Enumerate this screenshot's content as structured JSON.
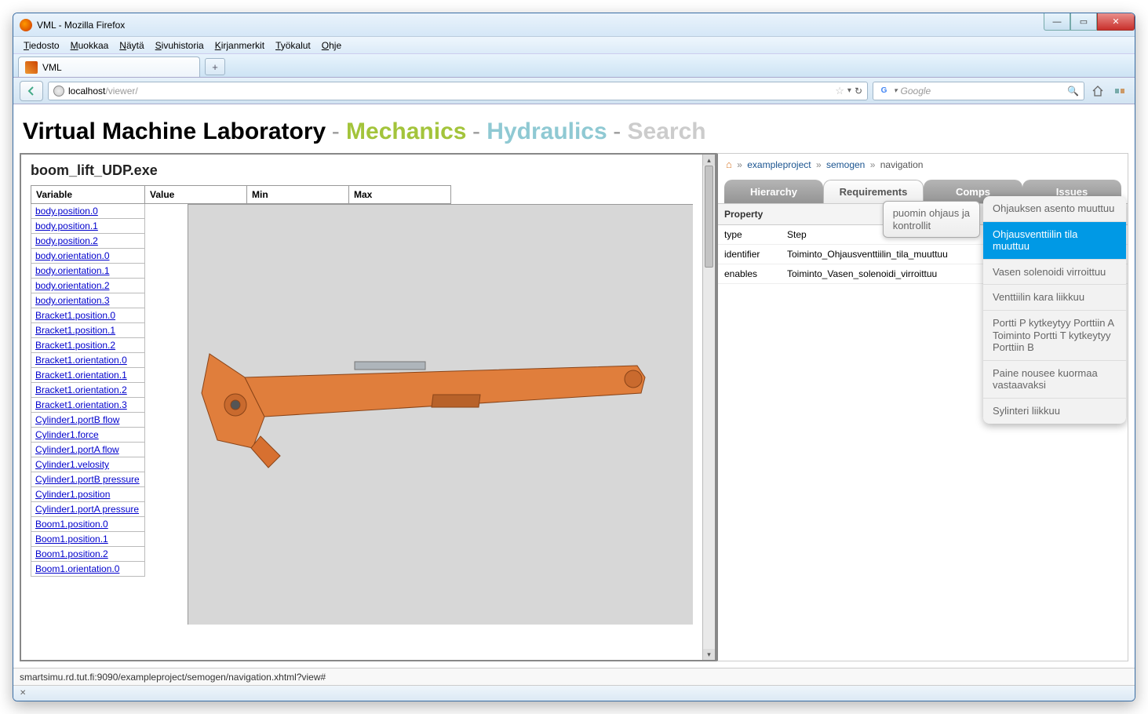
{
  "window": {
    "title": "VML - Mozilla Firefox"
  },
  "menubar": {
    "items": [
      "Tiedosto",
      "Muokkaa",
      "Näytä",
      "Sivuhistoria",
      "Kirjanmerkit",
      "Työkalut",
      "Ohje"
    ]
  },
  "tab": {
    "label": "VML"
  },
  "urlbar": {
    "host": "localhost",
    "path": "/viewer/"
  },
  "search": {
    "placeholder": "Google"
  },
  "page_title": {
    "part1": "Virtual Machine Laboratory",
    "part2": "Mechanics",
    "part3": "Hydraulics",
    "part4": "Search"
  },
  "left": {
    "exe_title": "boom_lift_UDP.exe",
    "columns": [
      "Variable",
      "Value",
      "Min",
      "Max"
    ],
    "variables": [
      "body.position.0",
      "body.position.1",
      "body.position.2",
      "body.orientation.0",
      "body.orientation.1",
      "body.orientation.2",
      "body.orientation.3",
      "Bracket1.position.0",
      "Bracket1.position.1",
      "Bracket1.position.2",
      "Bracket1.orientation.0",
      "Bracket1.orientation.1",
      "Bracket1.orientation.2",
      "Bracket1.orientation.3",
      "Cylinder1.portB flow",
      "Cylinder1.force",
      "Cylinder1.portA flow",
      "Cylinder1.velosity",
      "Cylinder1.portB pressure",
      "Cylinder1.position",
      "Cylinder1.portA pressure",
      "Boom1.position.0",
      "Boom1.position.1",
      "Boom1.position.2",
      "Boom1.orientation.0"
    ]
  },
  "right": {
    "breadcrumb": {
      "items": [
        "exampleproject",
        "semogen",
        "navigation"
      ]
    },
    "tabs": [
      "Hierarchy",
      "Requirements",
      "Comps",
      "Issues"
    ],
    "prop_header": "Property",
    "rows": [
      {
        "k": "type",
        "v": "Step"
      },
      {
        "k": "identifier",
        "v": "Toiminto_Ohjausventtiilin_tila_muuttuu"
      },
      {
        "k": "enables",
        "v": "Toiminto_Vasen_solenoidi_virroittuu"
      }
    ],
    "tooltip": "puomin ohjaus ja\nkontrollit",
    "popup": [
      {
        "label": "Ohjauksen asento muuttuu",
        "sel": false
      },
      {
        "label": "Ohjausventtiilin tila muuttuu",
        "sel": true
      },
      {
        "label": "Vasen solenoidi virroittuu",
        "sel": false
      },
      {
        "label": "Venttiilin kara liikkuu",
        "sel": false
      },
      {
        "label": "Portti P kytkeytyy Porttiin A Toiminto Portti T kytkeytyy Porttiin B",
        "sel": false
      },
      {
        "label": "Paine nousee kuormaa vastaavaksi",
        "sel": false
      },
      {
        "label": "Sylinteri liikkuu",
        "sel": false
      }
    ]
  },
  "statusbar": {
    "text": "smartsimu.rd.tut.fi:9090/exampleproject/semogen/navigation.xhtml?view#"
  }
}
